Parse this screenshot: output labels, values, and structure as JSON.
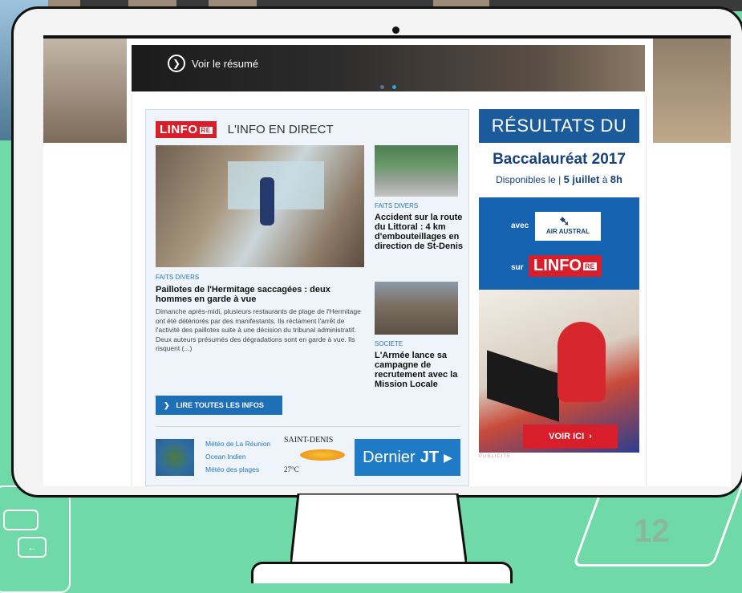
{
  "slider": {
    "resume_label": "Voir le résumé"
  },
  "panel": {
    "logo": "LINFO",
    "logo_suffix": "RE",
    "heading": "L'INFO EN DIRECT",
    "main_article": {
      "category": "FAITS DIVERS",
      "title": "Paillotes de l'Hermitage saccagées : deux hommes en garde à vue",
      "excerpt": "Dimanche après-midi, plusieurs restaurants de plage de l'Hermitage ont été détériorés par des manifestants. Ils réclament l'arrêt de l'activité des paillotes suite à une décision du tribunal administratif. Deux auteurs présumés des dégradations sont en garde à vue. Ils risquent (...)"
    },
    "articles": [
      {
        "category": "FAITS DIVERS",
        "title": "Accident sur la route du Littoral : 4 km d'embouteillages en direction de St-Denis"
      },
      {
        "category": "SOCIETE",
        "title": "L'Armée lance sa campagne de recrutement avec la Mission Locale"
      }
    ],
    "read_all_label": "LIRE TOUTES LES INFOS",
    "meteo_links": [
      "Météo de La Réunion",
      "Ocean Indien",
      "Météo des plages"
    ],
    "city": "SAINT-DENIS",
    "temperature": "27°C",
    "jt_label": "Dernier",
    "jt_bold": "JT"
  },
  "ad": {
    "headline": "RÉSULTATS DU",
    "bac": "Baccalauréat 2017",
    "dispo": "Disponibles le",
    "date": "5 juillet",
    "at": "à",
    "hour": "8h",
    "avec": "avec",
    "partner": "AIR AUSTRAL",
    "sur": "sur",
    "logo": "LINFO",
    "logo_suffix": "RE",
    "cta": "VOIR ICI",
    "pub": "PUBLICITE"
  },
  "slide_number": "12",
  "colors": {
    "accent_blue": "#1d6fb8",
    "brand_red": "#d81e2a",
    "background": "#6fdaa8"
  }
}
